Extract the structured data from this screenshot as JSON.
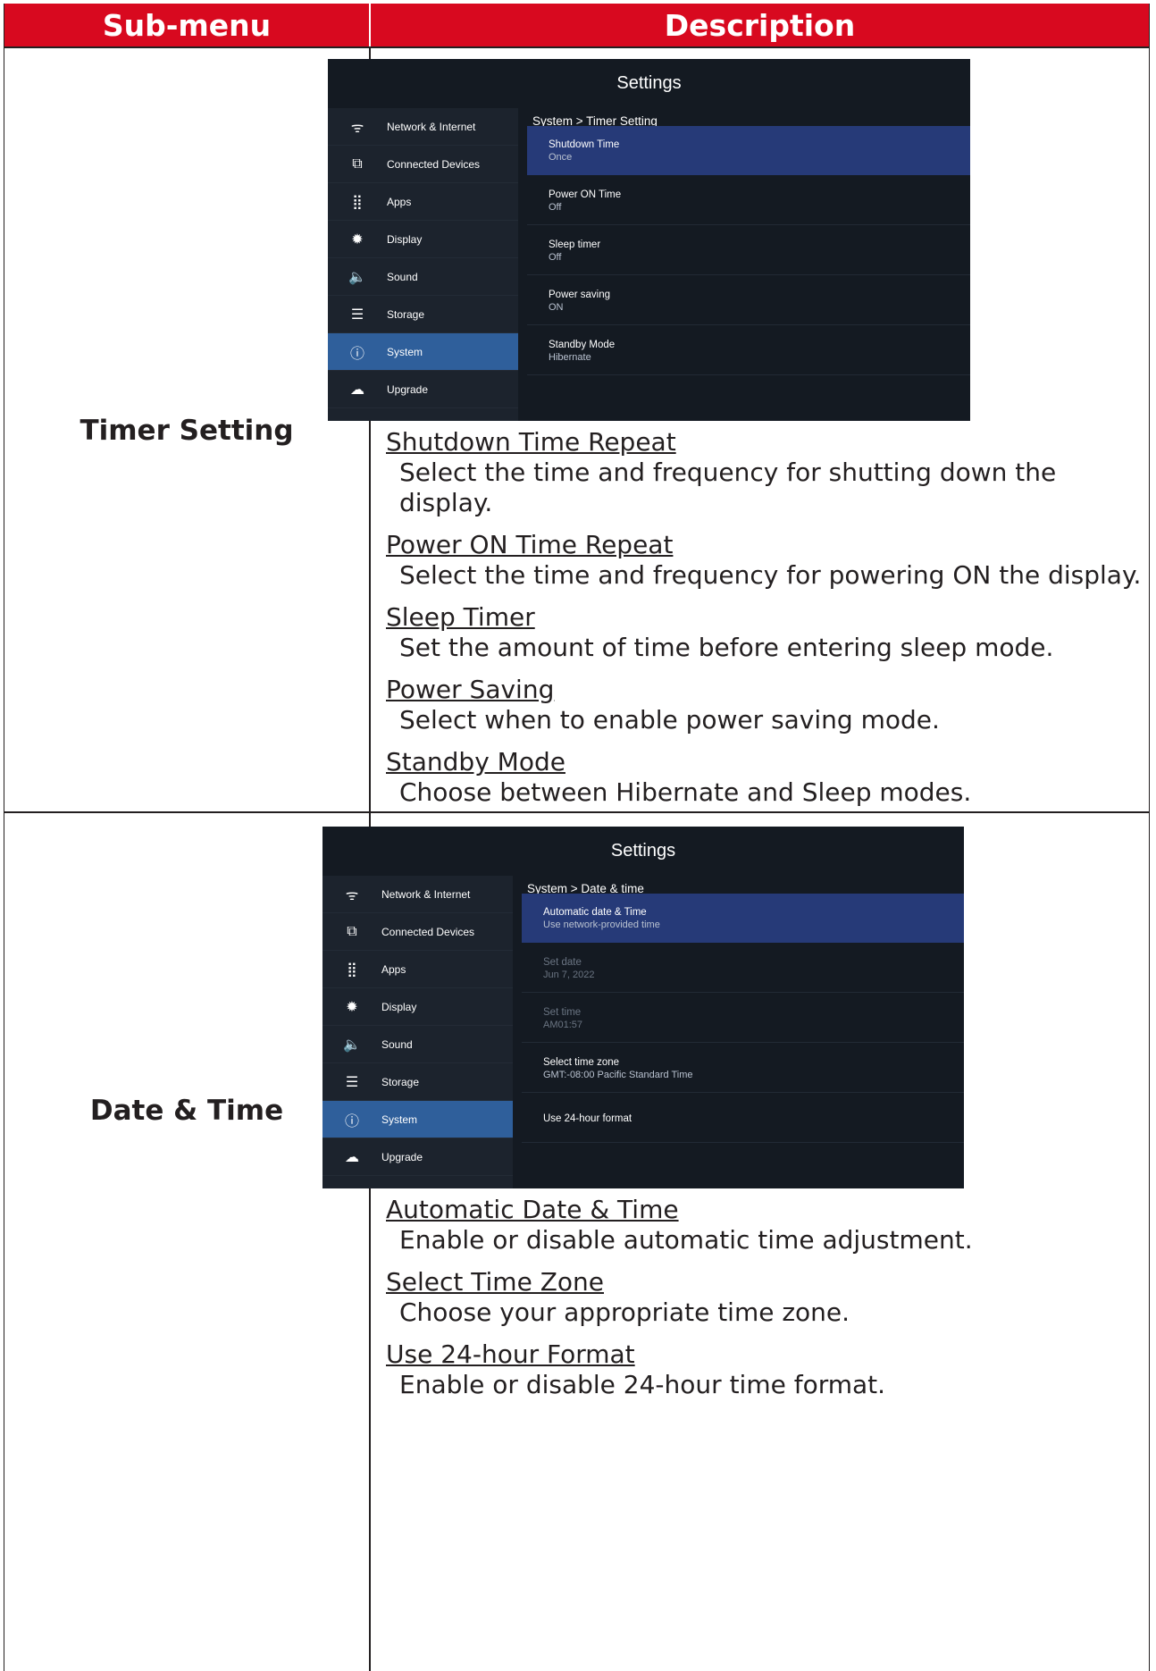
{
  "header": {
    "col1": "Sub-menu",
    "col2": "Description"
  },
  "rows": [
    {
      "submenu": "Timer Setting",
      "screen": {
        "title": "Settings",
        "sidebar": [
          {
            "icon": "wifi-icon",
            "glyph": "ᯤ",
            "label": "Network & Internet"
          },
          {
            "icon": "devices-icon",
            "glyph": "⧉",
            "label": "Connected Devices"
          },
          {
            "icon": "apps-grid-icon",
            "glyph": "⣿",
            "label": "Apps"
          },
          {
            "icon": "display-brightness-icon",
            "glyph": "✹",
            "label": "Display"
          },
          {
            "icon": "speaker-icon",
            "glyph": "🔈",
            "label": "Sound"
          },
          {
            "icon": "storage-icon",
            "glyph": "☰",
            "label": "Storage"
          },
          {
            "icon": "info-circle-icon",
            "glyph": "ⓘ",
            "label": "System",
            "active": true
          },
          {
            "icon": "cloud-upload-icon",
            "glyph": "☁",
            "label": "Upgrade"
          }
        ],
        "breadcrumb": "System > Timer Setting",
        "options": [
          {
            "title": "Shutdown Time",
            "value": "Once",
            "active": true
          },
          {
            "title": "Power ON Time",
            "value": "Off"
          },
          {
            "title": "Sleep timer",
            "value": "Off"
          },
          {
            "title": "Power saving",
            "value": "ON"
          },
          {
            "title": "Standby Mode",
            "value": "Hibernate"
          }
        ]
      },
      "descriptions": [
        {
          "heading": "Shutdown Time Repeat",
          "body_line1": "Select the time and frequency for shutting down the",
          "body_line2": "display."
        },
        {
          "heading": "Power ON Time Repeat",
          "body_line1": "Select the time and frequency for powering ON the display."
        },
        {
          "heading": "Sleep Timer",
          "body_line1": "Set the amount of time before entering sleep mode."
        },
        {
          "heading": "Power Saving",
          "body_line1": "Select when to enable power saving mode."
        },
        {
          "heading": "Standby Mode",
          "body_line1": "Choose between Hibernate and Sleep modes."
        }
      ]
    },
    {
      "submenu": "Date & Time",
      "screen": {
        "title": "Settings",
        "sidebar": [
          {
            "icon": "wifi-icon",
            "glyph": "ᯤ",
            "label": "Network & Internet"
          },
          {
            "icon": "devices-icon",
            "glyph": "⧉",
            "label": "Connected Devices"
          },
          {
            "icon": "apps-grid-icon",
            "glyph": "⣿",
            "label": "Apps"
          },
          {
            "icon": "display-brightness-icon",
            "glyph": "✹",
            "label": "Display"
          },
          {
            "icon": "speaker-icon",
            "glyph": "🔈",
            "label": "Sound"
          },
          {
            "icon": "storage-icon",
            "glyph": "☰",
            "label": "Storage"
          },
          {
            "icon": "info-circle-icon",
            "glyph": "ⓘ",
            "label": "System",
            "active": true
          },
          {
            "icon": "cloud-upload-icon",
            "glyph": "☁",
            "label": "Upgrade"
          }
        ],
        "breadcrumb": "System > Date & time",
        "options": [
          {
            "title": "Automatic date & Time",
            "value": "Use network-provided time",
            "active": true,
            "toggle": "on"
          },
          {
            "title": "Set date",
            "value": "Jun 7, 2022",
            "dim": true
          },
          {
            "title": "Set time",
            "value": "AM01:57",
            "dim": true
          },
          {
            "title": "Select time zone",
            "value": "GMT:-08:00 Pacific Standard Time"
          },
          {
            "title": "Use 24-hour format",
            "value": "",
            "toggle": "off"
          }
        ]
      },
      "descriptions": [
        {
          "heading": "Automatic Date & Time",
          "body_line1": "Enable or disable automatic time adjustment."
        },
        {
          "heading": "Select Time Zone",
          "body_line1": "Choose your appropriate time zone."
        },
        {
          "heading": "Use 24-hour Format",
          "body_line1": "Enable or disable 24-hour time format."
        }
      ]
    }
  ]
}
